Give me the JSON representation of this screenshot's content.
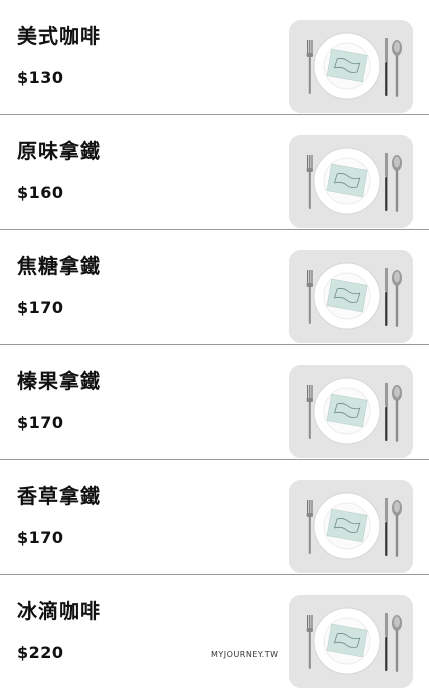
{
  "menu": {
    "items": [
      {
        "name": "美式咖啡",
        "price": "$130",
        "image": "plate-place-setting"
      },
      {
        "name": "原味拿鐵",
        "price": "$160",
        "image": "plate-place-setting"
      },
      {
        "name": "焦糖拿鐵",
        "price": "$170",
        "image": "plate-place-setting"
      },
      {
        "name": "榛果拿鐵",
        "price": "$170",
        "image": "plate-place-setting"
      },
      {
        "name": "香草拿鐵",
        "price": "$170",
        "image": "plate-place-setting"
      },
      {
        "name": "冰滴咖啡",
        "price": "$220",
        "image": "plate-place-setting"
      }
    ]
  },
  "watermark": "MYJOURNEY.TW",
  "colors": {
    "background": "#ffffff",
    "divider": "#9a9a9a",
    "thumb_bg": "#e3e3e3",
    "napkin": "#cfe3df"
  }
}
